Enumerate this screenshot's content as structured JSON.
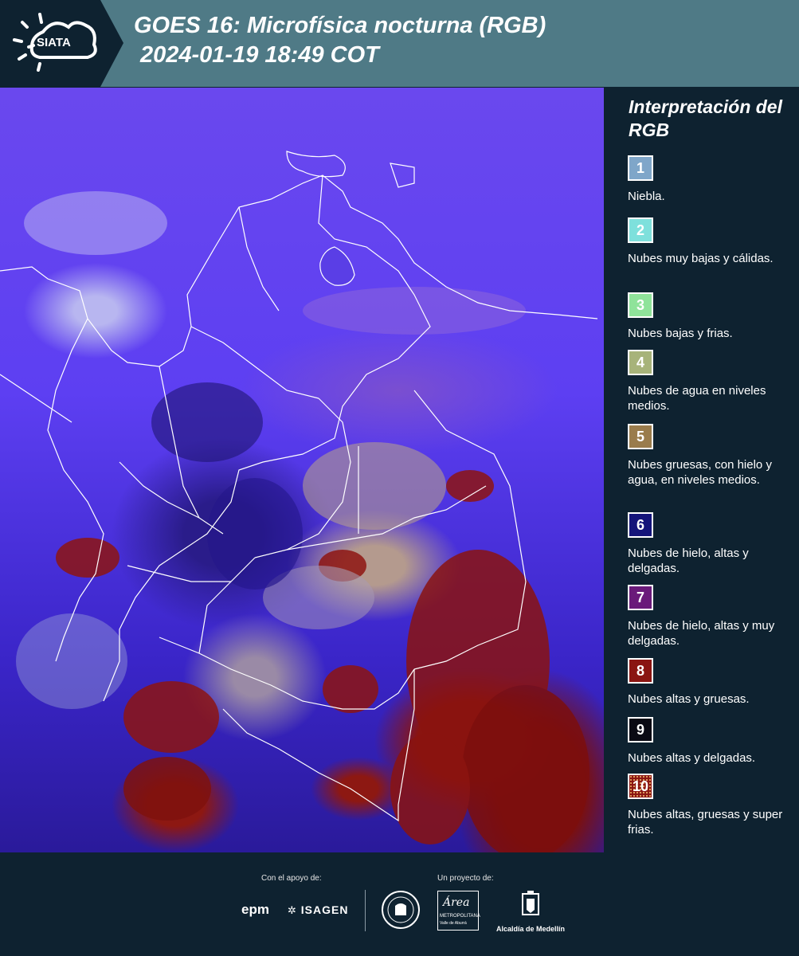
{
  "header": {
    "logo_text": "SIATA",
    "title_line1": "GOES 16: Microfísica nocturna (RGB)",
    "title_line2": "2024-01-19 18:49 COT"
  },
  "legend": {
    "title": "Interpretación del RGB",
    "items": [
      {
        "number": "1",
        "color": "#7fa6c9",
        "text": "Niebla."
      },
      {
        "number": "2",
        "color": "#7ee0dc",
        "text": "Nubes muy bajas y cálidas."
      },
      {
        "number": "3",
        "color": "#8fe39a",
        "text": "Nubes bajas y frias."
      },
      {
        "number": "4",
        "color": "#a7b37a",
        "text": "Nubes de agua en niveles medios."
      },
      {
        "number": "5",
        "color": "#9a7c4c",
        "text": "Nubes gruesas, con hielo y agua, en niveles medios."
      },
      {
        "number": "6",
        "color": "#14147a",
        "text": "Nubes de hielo, altas y delgadas."
      },
      {
        "number": "7",
        "color": "#6a1a7a",
        "text": "Nubes de hielo, altas y muy delgadas."
      },
      {
        "number": "8",
        "color": "#8a1512",
        "text": "Nubes altas y gruesas."
      },
      {
        "number": "9",
        "color": "#0a0a14",
        "text": "Nubes altas y delgadas."
      },
      {
        "number": "10",
        "color": "#8a1512",
        "text": "Nubes altas, gruesas y super frias."
      }
    ]
  },
  "footer": {
    "support_label": "Con el apoyo de:",
    "project_label": "Un proyecto de:",
    "sponsor1": "epm",
    "sponsor2": "ISAGEN",
    "partner_area_line1": "Área",
    "partner_area_line2": "METROPOLITANA",
    "partner_area_line3": "Valle de Aburrá",
    "partner_alcaldia": "Alcaldía de Medellín"
  }
}
